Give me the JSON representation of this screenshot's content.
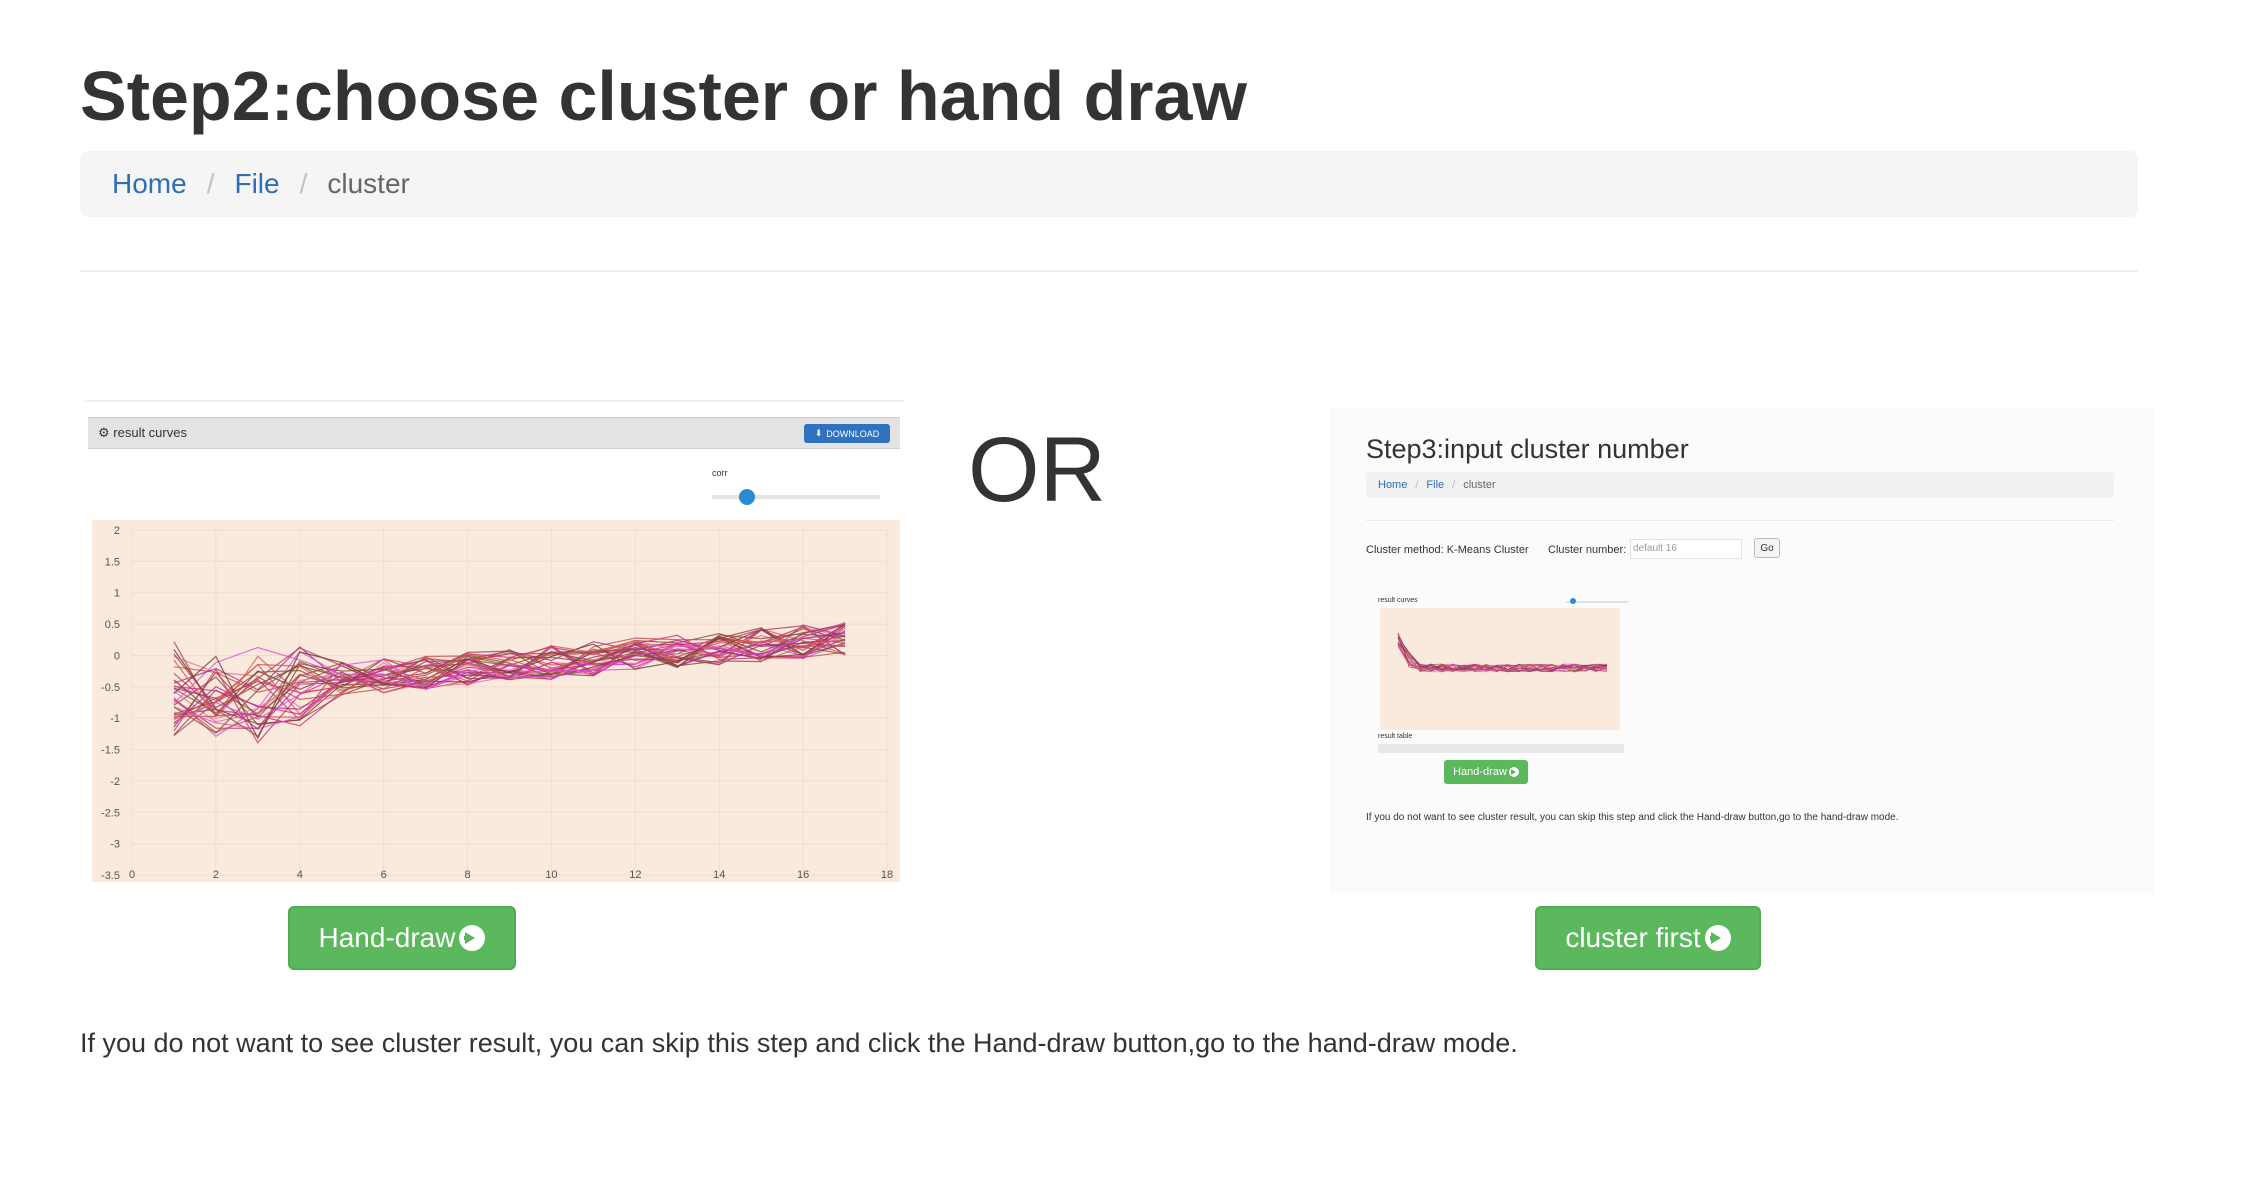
{
  "page": {
    "title": "Step2:choose cluster or hand draw",
    "note": "If you do not want to see cluster result, you can skip this step and click the Hand-draw button,go to the hand-draw mode.",
    "or_text": "OR"
  },
  "breadcrumb": {
    "home": "Home",
    "file": "File",
    "current": "cluster",
    "separator": "/"
  },
  "left_preview": {
    "panel_title": "result curves",
    "download_label": "DOWNLOAD",
    "slider_label": "corr",
    "y_ticks": [
      "2",
      "1.5",
      "1",
      "0.5",
      "0",
      "-0.5",
      "-1",
      "-1.5",
      "-2",
      "-2.5",
      "-3",
      "-3.5"
    ],
    "x_ticks": [
      "0",
      "2",
      "4",
      "6",
      "8",
      "10",
      "12",
      "14",
      "16",
      "18"
    ],
    "plot_bg": "#faeadd"
  },
  "right_preview": {
    "title": "Step3:input cluster number",
    "breadcrumb_home": "Home",
    "breadcrumb_file": "File",
    "breadcrumb_current": "cluster",
    "cluster_method": "Cluster method: K-Means Cluster",
    "cluster_number_label": "Cluster number:",
    "cluster_number_placeholder": "default 16",
    "go_label": "Go",
    "result_curves_label": "result curves",
    "result_table_label": "result table",
    "hand_draw_label": "Hand-draw",
    "note": "If you do not want to see cluster result, you can skip this step and click the Hand-draw button,go to the hand-draw mode."
  },
  "buttons": {
    "hand_draw": "Hand-draw",
    "cluster_first": "cluster first"
  },
  "colors": {
    "accent_green": "#5cb85c",
    "link_blue": "#2f6db5",
    "download_blue": "#2f72c0"
  }
}
